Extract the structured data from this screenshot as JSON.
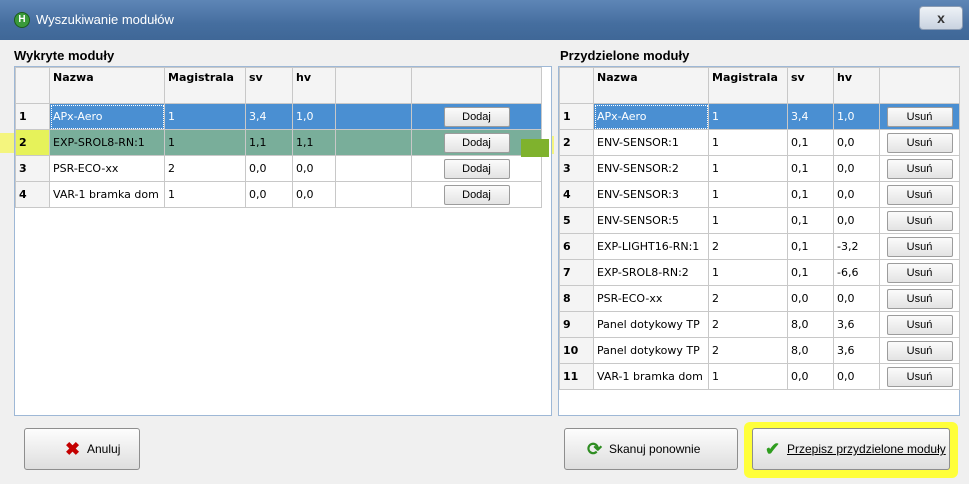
{
  "window": {
    "title": "Wyszukiwanie modułów",
    "close_label": "x"
  },
  "left_panel": {
    "label": "Wykryte moduły",
    "columns": [
      "Nazwa",
      "Magistrala",
      "sv",
      "hv",
      ""
    ],
    "rows": [
      {
        "num": "1",
        "name": "APx-Aero",
        "bus": "1",
        "sv": "3,4",
        "hv": "1,0",
        "button": "Dodaj"
      },
      {
        "num": "2",
        "name": "EXP-SROL8-RN:1",
        "bus": "1",
        "sv": "1,1",
        "hv": "1,1",
        "button": "Dodaj"
      },
      {
        "num": "3",
        "name": "PSR-ECO-xx",
        "bus": "2",
        "sv": "0,0",
        "hv": "0,0",
        "button": "Dodaj"
      },
      {
        "num": "4",
        "name": "VAR-1 bramka dom",
        "bus": "1",
        "sv": "0,0",
        "hv": "0,0",
        "button": "Dodaj"
      }
    ]
  },
  "right_panel": {
    "label": "Przydzielone moduły",
    "columns": [
      "Nazwa",
      "Magistrala",
      "sv",
      "hv",
      ""
    ],
    "rows": [
      {
        "num": "1",
        "name": "APx-Aero",
        "bus": "1",
        "sv": "3,4",
        "hv": "1,0",
        "button": "Usuń"
      },
      {
        "num": "2",
        "name": "ENV-SENSOR:1",
        "bus": "1",
        "sv": "0,1",
        "hv": "0,0",
        "button": "Usuń"
      },
      {
        "num": "3",
        "name": "ENV-SENSOR:2",
        "bus": "1",
        "sv": "0,1",
        "hv": "0,0",
        "button": "Usuń"
      },
      {
        "num": "4",
        "name": "ENV-SENSOR:3",
        "bus": "1",
        "sv": "0,1",
        "hv": "0,0",
        "button": "Usuń"
      },
      {
        "num": "5",
        "name": "ENV-SENSOR:5",
        "bus": "1",
        "sv": "0,1",
        "hv": "0,0",
        "button": "Usuń"
      },
      {
        "num": "6",
        "name": "EXP-LIGHT16-RN:1",
        "bus": "2",
        "sv": "0,1",
        "hv": "-3,2",
        "button": "Usuń"
      },
      {
        "num": "7",
        "name": "EXP-SROL8-RN:2",
        "bus": "1",
        "sv": "0,1",
        "hv": "-6,6",
        "button": "Usuń"
      },
      {
        "num": "8",
        "name": "PSR-ECO-xx",
        "bus": "2",
        "sv": "0,0",
        "hv": "0,0",
        "button": "Usuń"
      },
      {
        "num": "9",
        "name": "Panel dotykowy TP",
        "bus": "2",
        "sv": "8,0",
        "hv": "3,6",
        "button": "Usuń"
      },
      {
        "num": "10",
        "name": "Panel dotykowy TP",
        "bus": "2",
        "sv": "8,0",
        "hv": "3,6",
        "button": "Usuń"
      },
      {
        "num": "11",
        "name": "VAR-1 bramka dom",
        "bus": "1",
        "sv": "0,0",
        "hv": "0,0",
        "button": "Usuń"
      }
    ]
  },
  "footer": {
    "cancel_label": "Anuluj",
    "rescan_label": "Skanuj ponownie",
    "copy_label": "Przepisz przydzielone moduły"
  },
  "colors": {
    "selection": "#4a8fd2",
    "assigned_highlight": "#79ae9a",
    "annotation_yellow": "#ffff3a"
  }
}
